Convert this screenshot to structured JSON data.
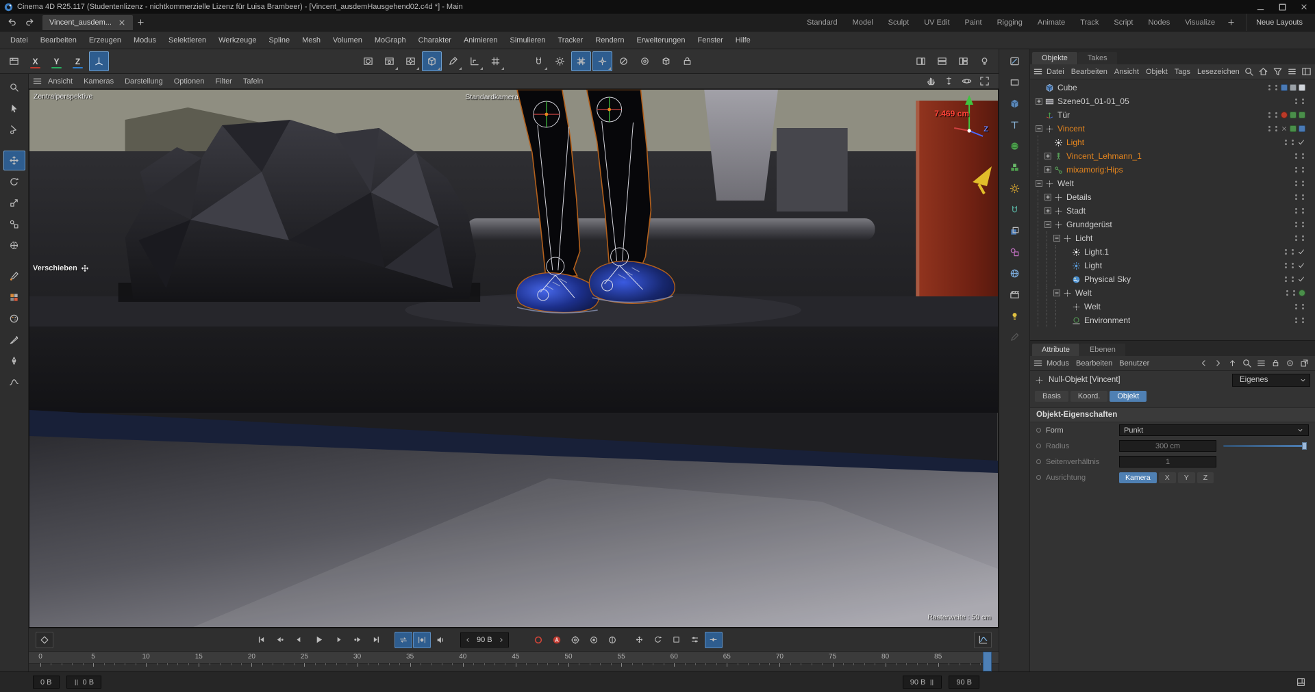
{
  "accents": {
    "selection_blue": "#4f80b3",
    "object_orange": "#e8871e",
    "record_red": "#c03a30",
    "axis_x": "#c0392b",
    "axis_y": "#27ae60",
    "axis_z": "#2d7fd0"
  },
  "titlebar": {
    "title": "Cinema 4D R25.117 (Studentenlizenz - nichtkommerzielle Lizenz für Luisa Brambeer) - [Vincent_ausdemHausgehend02.c4d *] - Main",
    "window_controls": [
      {
        "name": "minimize-button",
        "icon": "minimize"
      },
      {
        "name": "maximize-button",
        "icon": "maximize"
      },
      {
        "name": "close-button",
        "icon": "close"
      }
    ]
  },
  "tabrow": {
    "history": [
      {
        "name": "undo-button",
        "icon": "undo"
      },
      {
        "name": "redo-button",
        "icon": "redo"
      }
    ],
    "document_tab": {
      "label": "Vincent_ausdem...",
      "close_icon": "close"
    },
    "add_tab_icon": "plus",
    "layout_tabs": [
      "Standard",
      "Model",
      "Sculpt",
      "UV Edit",
      "Paint",
      "Rigging",
      "Animate",
      "Track",
      "Script",
      "Nodes",
      "Visualize"
    ],
    "add_layout_icon": "plus",
    "new_layouts_label": "Neue Layouts"
  },
  "menubar": {
    "items": [
      "Datei",
      "Bearbeiten",
      "Erzeugen",
      "Modus",
      "Selektieren",
      "Werkzeuge",
      "Spline",
      "Mesh",
      "Volumen",
      "MoGraph",
      "Charakter",
      "Animieren",
      "Simulieren",
      "Tracker",
      "Rendern",
      "Erweiterungen",
      "Fenster",
      "Hilfe"
    ]
  },
  "toolbar": {
    "left_group": [
      {
        "name": "solo-viewport-button",
        "icon": "viewport"
      },
      {
        "name": "axis-lock-x-button",
        "label": "X",
        "underline": "#c0392b"
      },
      {
        "name": "axis-lock-y-button",
        "label": "Y",
        "underline": "#27ae60"
      },
      {
        "name": "axis-lock-z-button",
        "label": "Z",
        "underline": "#2d7fd0"
      },
      {
        "name": "coordinate-system-button",
        "icon": "coord",
        "active": true
      }
    ],
    "center_group": [
      {
        "name": "render-view-button",
        "icon": "renderview"
      },
      {
        "name": "render-picture-viewer-button",
        "icon": "renderpv",
        "pop": true
      },
      {
        "name": "render-settings-button",
        "icon": "rendersettings",
        "pop": true
      },
      {
        "name": "primitive-cube-button",
        "icon": "cube",
        "active": true,
        "pop": true
      },
      {
        "name": "spline-pen-button",
        "icon": "pen",
        "pop": true
      },
      {
        "name": "workplane-button",
        "icon": "workplane",
        "pop": true
      },
      {
        "name": "workplane-grid-button",
        "icon": "gridsmall",
        "pop": true
      }
    ],
    "snap_group": [
      {
        "name": "snap-toggle-button",
        "icon": "magnet",
        "pop": true
      },
      {
        "name": "modeling-settings-button",
        "icon": "gear"
      },
      {
        "name": "grid-snap-button",
        "icon": "grid",
        "active": true
      },
      {
        "name": "quantize-button",
        "icon": "grid2",
        "active": true,
        "pop": true
      },
      {
        "name": "simulation-toggle-button",
        "icon": "circleslash"
      },
      {
        "name": "simulation-settings-button",
        "icon": "gearcircle"
      },
      {
        "name": "simulation-cube-button",
        "icon": "simcube"
      },
      {
        "name": "simulation-cache-button",
        "icon": "lockcube"
      }
    ],
    "right_group": [
      {
        "name": "layout-preset-1-button",
        "icon": "tiles"
      },
      {
        "name": "layout-preset-2-button",
        "icon": "tiles2"
      },
      {
        "name": "layout-preset-3-button",
        "icon": "tiles3"
      },
      {
        "name": "gpu-render-light-button",
        "icon": "bulb"
      }
    ]
  },
  "side_toolbar": {
    "tools": [
      {
        "name": "zoom-tool",
        "icon": "zoomtool"
      },
      {
        "name": "live-selection-tool",
        "icon": "cursor"
      },
      {
        "name": "tweak-tool",
        "icon": "tweak"
      },
      {
        "gap": true
      },
      {
        "name": "move-tool",
        "icon": "move",
        "active": true
      },
      {
        "name": "rotate-tool",
        "icon": "rotate"
      },
      {
        "name": "scale-tool",
        "icon": "scale"
      },
      {
        "name": "transfer-tool",
        "icon": "transfer"
      },
      {
        "name": "snap-settings-tool",
        "icon": "snapsettings"
      },
      {
        "gap": true
      },
      {
        "name": "paint-brush-tool",
        "icon": "brushcolor"
      },
      {
        "name": "color-swatch-tool",
        "icon": "swatch"
      },
      {
        "name": "palette-tool",
        "icon": "palette"
      },
      {
        "name": "knife-tool",
        "icon": "knife"
      },
      {
        "name": "spline-pen-tool",
        "icon": "pen2"
      },
      {
        "name": "spline-smooth-tool",
        "icon": "smooth"
      }
    ]
  },
  "viewport": {
    "menu_items": [
      "Ansicht",
      "Kameras",
      "Darstellung",
      "Optionen",
      "Filter",
      "Tafeln"
    ],
    "nav_icons": [
      {
        "name": "pan-view-button",
        "icon": "hand"
      },
      {
        "name": "dolly-view-button",
        "icon": "dolly"
      },
      {
        "name": "orbit-view-button",
        "icon": "orbit"
      },
      {
        "name": "toggle-single-view-button",
        "icon": "frame"
      }
    ],
    "perspective_label": "Zentralperspektive",
    "camera_label": "Standardkamera",
    "tool_hint": "Verschieben",
    "hud_distance": "7.469 cm",
    "hud_axis_z": "Z",
    "grid_label": "Rasterweite : 50 cm"
  },
  "object_manager": {
    "tabs": [
      {
        "label": "Objekte",
        "active": true
      },
      {
        "label": "Takes",
        "active": false
      }
    ],
    "menu_items": [
      "Datei",
      "Bearbeiten",
      "Ansicht",
      "Objekt",
      "Tags",
      "Lesezeichen"
    ],
    "header_icons": [
      {
        "name": "om-search-button",
        "icon": "zoomtool"
      },
      {
        "name": "om-home-button",
        "icon": "home"
      },
      {
        "name": "om-filter-button",
        "icon": "filter"
      },
      {
        "name": "om-list-button",
        "icon": "list"
      },
      {
        "name": "om-panel-button",
        "icon": "panel"
      }
    ],
    "tree": [
      {
        "label": "Cube",
        "depth": 0,
        "icon": "cube",
        "badges": [
          {
            "c": "#4a7ab5"
          },
          {
            "c": "#9aa0a6"
          },
          {
            "c": "#d0d4da"
          }
        ]
      },
      {
        "label": "Szene01_01-01_05",
        "depth": 0,
        "icon": "film",
        "expand": "closed"
      },
      {
        "label": "Tür",
        "depth": 0,
        "icon": "axis",
        "badges": [
          {
            "c": "#bb3a28",
            "s": "ball"
          },
          {
            "c": "#4a8f4a"
          },
          {
            "c": "#4a8f4a"
          }
        ]
      },
      {
        "label": "Vincent",
        "depth": 0,
        "icon": "null",
        "expand": "open",
        "color": "orange",
        "cross": true,
        "badges": [
          {
            "c": "#4a8f4a"
          },
          {
            "c": "#4a7ab5"
          }
        ]
      },
      {
        "label": "Light",
        "depth": 1,
        "icon": "light",
        "color": "orange",
        "check": true
      },
      {
        "label": "Vincent_Lehmann_1",
        "depth": 1,
        "icon": "figure",
        "expand": "closed",
        "color": "orange"
      },
      {
        "label": "mixamorig:Hips",
        "depth": 1,
        "icon": "joint",
        "expand": "closed",
        "color": "orange"
      },
      {
        "label": "Welt",
        "depth": 0,
        "icon": "null",
        "expand": "open"
      },
      {
        "label": "Details",
        "depth": 1,
        "icon": "null",
        "expand": "closed"
      },
      {
        "label": "Stadt",
        "depth": 1,
        "icon": "null",
        "expand": "closed"
      },
      {
        "label": "Grundgerüst",
        "depth": 1,
        "icon": "null",
        "expand": "open"
      },
      {
        "label": "Licht",
        "depth": 2,
        "icon": "null",
        "expand": "open"
      },
      {
        "label": "Light.1",
        "depth": 3,
        "icon": "light",
        "check": true
      },
      {
        "label": "Light",
        "depth": 3,
        "icon": "light-blue",
        "check": true
      },
      {
        "label": "Physical Sky",
        "depth": 3,
        "icon": "sky",
        "check": true
      },
      {
        "label": "Welt",
        "depth": 2,
        "icon": "null",
        "expand": "open",
        "badges": [
          {
            "c": "#4a8f4a",
            "s": "ball"
          }
        ]
      },
      {
        "label": "Welt",
        "depth": 3,
        "icon": "null"
      },
      {
        "label": "Environment",
        "depth": 3,
        "icon": "environment"
      }
    ]
  },
  "attributes": {
    "tabs": [
      {
        "label": "Attribute",
        "active": true
      },
      {
        "label": "Ebenen",
        "active": false
      }
    ],
    "menu_items": [
      "Modus",
      "Bearbeiten",
      "Benutzer"
    ],
    "header_icons": [
      {
        "name": "attr-back-button",
        "icon": "back"
      },
      {
        "name": "attr-forward-button",
        "icon": "forward"
      },
      {
        "name": "attr-up-button",
        "icon": "up"
      },
      {
        "name": "attr-search-button",
        "icon": "zoomtool"
      },
      {
        "name": "attr-list-button",
        "icon": "list"
      },
      {
        "name": "attr-lock-button",
        "icon": "lock"
      },
      {
        "name": "attr-target-button",
        "icon": "target"
      },
      {
        "name": "attr-popout-button",
        "icon": "popout"
      }
    ],
    "object_title": "Null-Objekt [Vincent]",
    "preset_value": "Eigenes",
    "section_tabs": [
      {
        "label": "Basis",
        "active": false
      },
      {
        "label": "Koord.",
        "active": false
      },
      {
        "label": "Objekt",
        "active": true
      }
    ],
    "section_header": "Objekt-Eigenschaften",
    "rows": [
      {
        "label": "Form",
        "type": "dropdown",
        "value": "Punkt",
        "enabled": true
      },
      {
        "label": "Radius",
        "type": "slider",
        "value": "300 cm",
        "enabled": false
      },
      {
        "label": "Seitenverhältnis",
        "type": "number",
        "value": "1",
        "enabled": false
      },
      {
        "label": "Ausrichtung",
        "type": "buttons",
        "enabled": false,
        "options": [
          {
            "label": "Kamera",
            "active": true
          },
          {
            "label": "X"
          },
          {
            "label": "Y"
          },
          {
            "label": "Z"
          }
        ]
      }
    ]
  },
  "timeline": {
    "keyframe_button_icon": "diamondkey",
    "transport": [
      {
        "name": "goto-start-button",
        "icon": "skipstart"
      },
      {
        "name": "previous-key-button",
        "icon": "prevkey"
      },
      {
        "name": "previous-frame-button",
        "icon": "prevframe"
      },
      {
        "name": "play-button",
        "icon": "play",
        "wide": true
      },
      {
        "name": "next-frame-button",
        "icon": "nextframe"
      },
      {
        "name": "next-key-button",
        "icon": "nextkey"
      },
      {
        "name": "goto-end-button",
        "icon": "skipend"
      }
    ],
    "loop_group": [
      {
        "name": "loop-playback-button",
        "icon": "loop",
        "active": true
      },
      {
        "name": "show-keys-button",
        "icon": "keynav",
        "active": true
      },
      {
        "name": "sound-button",
        "icon": "speaker"
      }
    ],
    "frame_field": {
      "value": "90 B"
    },
    "record_group": [
      {
        "name": "record-keyframe-button",
        "icon": "record"
      },
      {
        "name": "autokey-button",
        "icon": "autokey"
      },
      {
        "name": "keying-settings-button",
        "icon": "gearcircle2"
      },
      {
        "name": "record-objects-button",
        "icon": "dotcircle"
      },
      {
        "name": "selection-keying-button",
        "icon": "slashcircle"
      }
    ],
    "key_filter_group": [
      {
        "name": "key-position-button",
        "icon": "poskey"
      },
      {
        "name": "key-rotation-button",
        "icon": "rotkey"
      },
      {
        "name": "key-scale-button",
        "icon": "boxkey"
      },
      {
        "name": "key-parameter-button",
        "icon": "paramskey"
      },
      {
        "name": "key-pla-button",
        "icon": "snapkey",
        "active": true
      }
    ],
    "fcurve_button": {
      "name": "fcurve-mode-button",
      "icon": "graph"
    },
    "ruler": {
      "labels": [
        0,
        5,
        10,
        15,
        20,
        25,
        30,
        35,
        40,
        45,
        50,
        55,
        60,
        65,
        70,
        75,
        80,
        85
      ],
      "end": 90,
      "current": 90
    },
    "range_bar": {
      "left": [
        {
          "name": "range-min-field",
          "value": "0 B"
        },
        {
          "name": "preview-min-field",
          "value": "0 B",
          "bars": "before"
        }
      ],
      "right": [
        {
          "name": "preview-max-field",
          "value": "90 B",
          "bars": "after"
        },
        {
          "name": "range-max-field",
          "value": "90 B"
        }
      ],
      "corner_icon": "cornerpanel"
    }
  },
  "side_palette": {
    "icons": [
      {
        "name": "sculpt-draw-tool",
        "icon": "tablet"
      },
      {
        "name": "rectangle-object-button",
        "icon": "rectshape"
      },
      {
        "name": "cube-object-button",
        "icon": "cube3d"
      },
      {
        "name": "text-object-button",
        "icon": "textobj"
      },
      {
        "name": "sphere-object-button",
        "icon": "sphereobj"
      },
      {
        "name": "cluster-object-button",
        "icon": "cubesobj"
      },
      {
        "name": "mograph-object-button",
        "icon": "gearcolor"
      },
      {
        "name": "dynamics-object-button",
        "icon": "magnet2"
      },
      {
        "name": "volume-object-button",
        "icon": "layersobj"
      },
      {
        "name": "field-object-button",
        "icon": "shapesobj"
      },
      {
        "name": "globe-object-button",
        "icon": "globeobj"
      },
      {
        "name": "camera-object-button",
        "icon": "clapobj"
      },
      {
        "name": "light-object-button",
        "icon": "bulb2"
      },
      {
        "name": "material-pen-button",
        "icon": "pen3",
        "dim": true
      }
    ]
  }
}
